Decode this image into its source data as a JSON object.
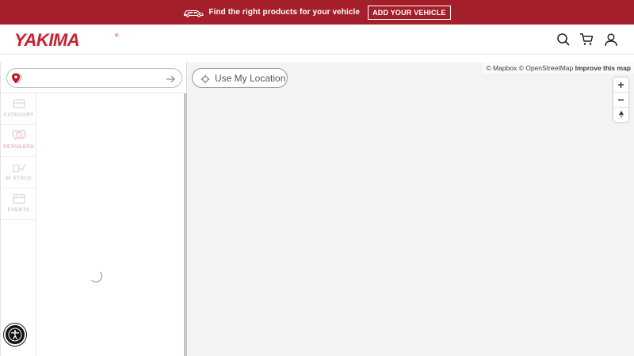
{
  "promo": {
    "message": "Find the right products for your vehicle",
    "button_label": "ADD YOUR VEHICLE",
    "background_color": "#a51f2a",
    "car_icon": "car-icon"
  },
  "header": {
    "logo_text": "YAKIMA",
    "logo_mark": "®",
    "brand_color": "#c8202f",
    "icons": [
      "search-icon",
      "cart-icon",
      "account-icon"
    ]
  },
  "sidebar": {
    "search": {
      "value": "",
      "placeholder": "",
      "pin_icon": "location-pin-icon",
      "submit_icon": "arrow-right-icon"
    },
    "tabs": [
      {
        "label": "CATEGORY",
        "icon": "category-icon",
        "active": false
      },
      {
        "label": "RETAILERS",
        "icon": "retailers-icon",
        "active": true
      },
      {
        "label": "IN STOCK",
        "icon": "in-stock-icon",
        "active": false
      },
      {
        "label": "EVENTS",
        "icon": "events-icon",
        "active": false
      }
    ],
    "loading": true
  },
  "map": {
    "use_location_label": "Use My Location",
    "attribution": {
      "mapbox": "© Mapbox",
      "osm": "© OpenStreetMap",
      "improve": "Improve this map"
    },
    "controls": {
      "zoom_in": "+",
      "zoom_out": "−",
      "reset": "reset-north-icon"
    }
  },
  "accessibility": {
    "icon": "accessibility-icon"
  }
}
